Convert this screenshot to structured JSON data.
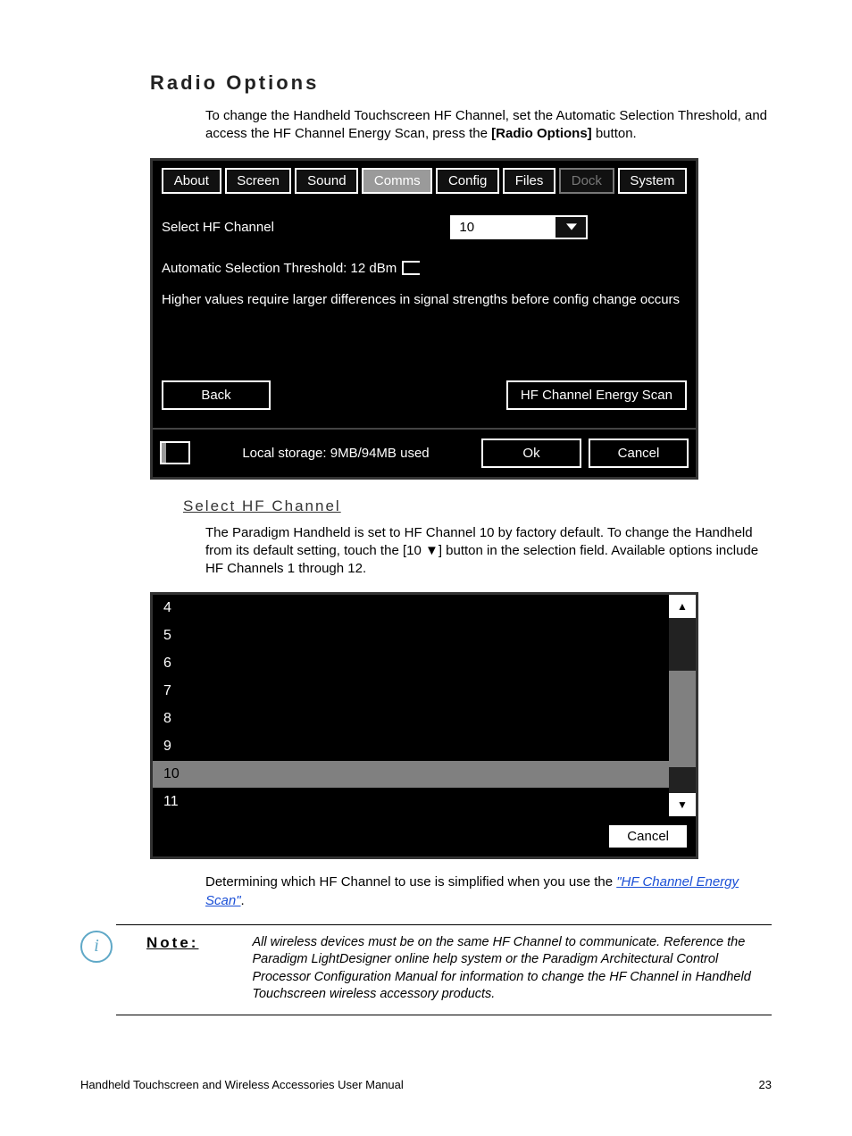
{
  "section_title": "Radio Options",
  "intro_text_a": "To change the Handheld Touchscreen HF Channel, set the Automatic Selection Threshold, and access the HF Channel Energy Scan, press the ",
  "intro_text_b": "[Radio Options]",
  "intro_text_c": " button.",
  "screenshot1": {
    "tabs": [
      "About",
      "Screen",
      "Sound",
      "Comms",
      "Config",
      "Files",
      "Dock",
      "System"
    ],
    "active_tab_index": 3,
    "disabled_tab_index": 6,
    "select_label": "Select HF Channel",
    "select_value": "10",
    "threshold_label": "Automatic Selection Threshold: 12 dBm",
    "hint_text": "Higher values require larger differences in signal strengths before config change occurs",
    "back_btn": "Back",
    "scan_btn": "HF Channel Energy Scan",
    "storage_text": "Local storage: 9MB/94MB used",
    "ok_btn": "Ok",
    "cancel_btn": "Cancel"
  },
  "subheading": "Select HF Channel",
  "para2_a": "The Paradigm Handheld is set to HF Channel 10 by factory default. To change the Handheld from its default setting, touch the [10 ▼] button in the selection field. ",
  "para2_b": "Available options include HF Channels 1 through 12.",
  "screenshot2": {
    "items": [
      "4",
      "5",
      "6",
      "7",
      "8",
      "9",
      "10",
      "11"
    ],
    "selected_index": 6,
    "cancel_btn": "Cancel"
  },
  "para3_a": "Determining which HF Channel to use is simplified when you use the ",
  "para3_link": "\"HF Channel Energy Scan\"",
  "para3_b": ".",
  "note_label": "Note:",
  "note_text": "All wireless devices must be on the same HF Channel to communicate. Reference the Paradigm LightDesigner online help system or the Paradigm Architectural Control Processor Configuration Manual for information to change the HF Channel in Handheld Touchscreen wireless accessory products.",
  "footer_left": "Handheld Touchscreen and Wireless Accessories User Manual",
  "footer_right": "23"
}
